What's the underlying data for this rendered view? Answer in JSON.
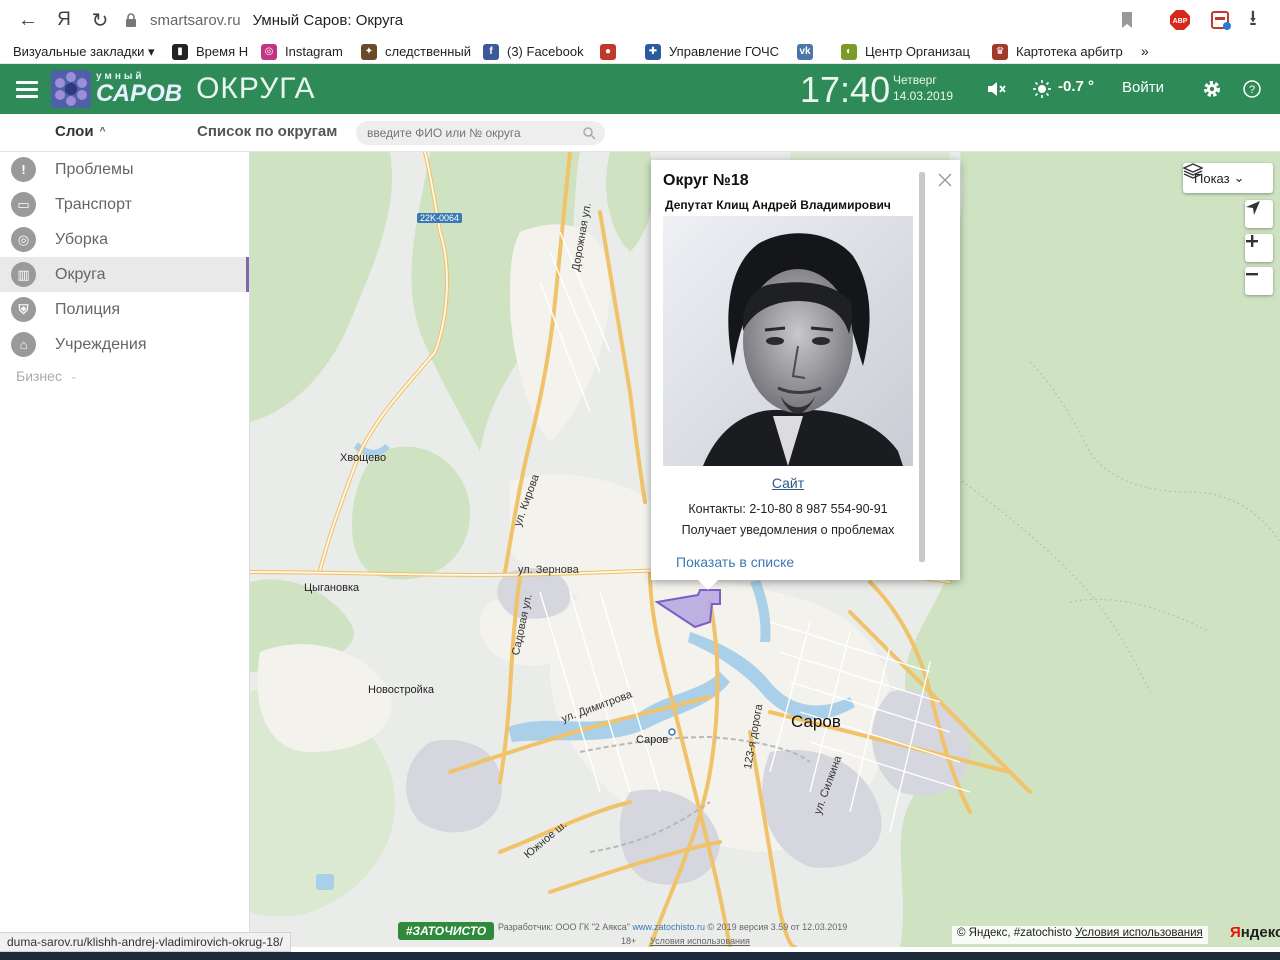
{
  "browser": {
    "domain": "smartsarov.ru",
    "tab_title": "Умный Саров: Округа",
    "back_glyph": "←",
    "yandex_glyph": "Я",
    "reload_glyph": "↻",
    "ext_abp": "ABP",
    "download_glyph": "⭳",
    "bookmarks": [
      {
        "label": "Визуальные закладки ▾",
        "icon": "none",
        "color": ""
      },
      {
        "label": "Время Н",
        "icon": "bars-icon",
        "color": "#222222"
      },
      {
        "label": "Instagram",
        "icon": "instagram-icon",
        "color": "#c13584"
      },
      {
        "label": "следственный",
        "icon": "emblem-icon",
        "color": "#6a4a2a"
      },
      {
        "label": "(3) Facebook",
        "icon": "facebook-icon",
        "color": "#3b5998"
      },
      {
        "label": "",
        "icon": "opera-icon",
        "color": "#c0392b"
      },
      {
        "label": "Управление ГОЧС",
        "icon": "gochs-icon",
        "color": "#2a5aa0"
      },
      {
        "label": "",
        "icon": "vk-icon",
        "color": "#4a76a8"
      },
      {
        "label": "Центр Организац",
        "icon": "center-icon",
        "color": "#7a9a2a"
      },
      {
        "label": "Картотека арбитр",
        "icon": "arbitr-icon",
        "color": "#a03a2a"
      }
    ],
    "bookmarks_more": "»"
  },
  "header": {
    "logo_small": "умный",
    "logo_big": "САРОВ",
    "section": "ОКРУГА",
    "time": "17:40",
    "weekday": "Четверг",
    "date": "14.03.2019",
    "temperature": "-0.7 °",
    "login": "Войти"
  },
  "subheader": {
    "layers": "Слои",
    "layers_caret": "^",
    "list": "Список по округам",
    "search_placeholder": "введите ФИО или № округа"
  },
  "sidebar": {
    "items": [
      {
        "label": "Проблемы",
        "icon": "exclamation-icon",
        "glyph": "!"
      },
      {
        "label": "Транспорт",
        "icon": "bus-icon",
        "glyph": "▭"
      },
      {
        "label": "Уборка",
        "icon": "tractor-icon",
        "glyph": "◎"
      },
      {
        "label": "Округа",
        "icon": "book-icon",
        "glyph": "▥"
      },
      {
        "label": "Полиция",
        "icon": "shield-icon",
        "glyph": "⛨"
      },
      {
        "label": "Учреждения",
        "icon": "building-icon",
        "glyph": "⌂"
      }
    ],
    "active_index": 3,
    "more": "Бизнес",
    "more_caret": "⌄"
  },
  "map": {
    "road_badge": "22K-0064",
    "labels": [
      {
        "text": "Хвощево",
        "kind": "village"
      },
      {
        "text": "Цыгановка",
        "kind": "village"
      },
      {
        "text": "Новостройка",
        "kind": "village"
      },
      {
        "text": "Саров",
        "kind": "station"
      },
      {
        "text": "Саров",
        "kind": "city"
      },
      {
        "text": "ул. Зернова",
        "kind": "street"
      },
      {
        "text": "ул. Кирова",
        "kind": "street"
      },
      {
        "text": "Дорожная ул.",
        "kind": "street"
      },
      {
        "text": "Садовая ул.",
        "kind": "street"
      },
      {
        "text": "ул. Димитрова",
        "kind": "street"
      },
      {
        "text": "123-я дорога",
        "kind": "street"
      },
      {
        "text": "ул. Силкина",
        "kind": "street"
      },
      {
        "text": "Южное ш.",
        "kind": "street"
      }
    ],
    "show_button": "Показ",
    "show_caret": "⌄"
  },
  "popup": {
    "title": "Округ №18",
    "deputy": "Депутат Клищ Андрей Владимирович",
    "site": "Сайт",
    "contacts": "Контакты: 2-10-80 8 987 554-90-91",
    "notify": "Получает уведомления о проблемах",
    "show_in_list": "Показать в списке"
  },
  "footer": {
    "brand": "#ЗАТОЧИСТО",
    "developer": "Разработчик: ООО ГК \"2 Аякса\"",
    "dev_link": "www.zatochisto.ru",
    "version": "© 2019 версия 3.59 от 12.03.2019",
    "age": "18+",
    "terms_small": "Условия использования",
    "yandex_copy": "© Яндекс, #zatochisto",
    "yandex_terms": "Условия использования",
    "yandex_logo_y": "Я",
    "yandex_logo_rest": "ндекс"
  },
  "status_url": "duma-sarov.ru/klishh-andrej-vladimirovich-okrug-18/",
  "colors": {
    "header_green": "#2e8b57",
    "district_fill": "#b3a6e0",
    "district_stroke": "#7b5fc8",
    "link_blue": "#3a7ab5"
  }
}
